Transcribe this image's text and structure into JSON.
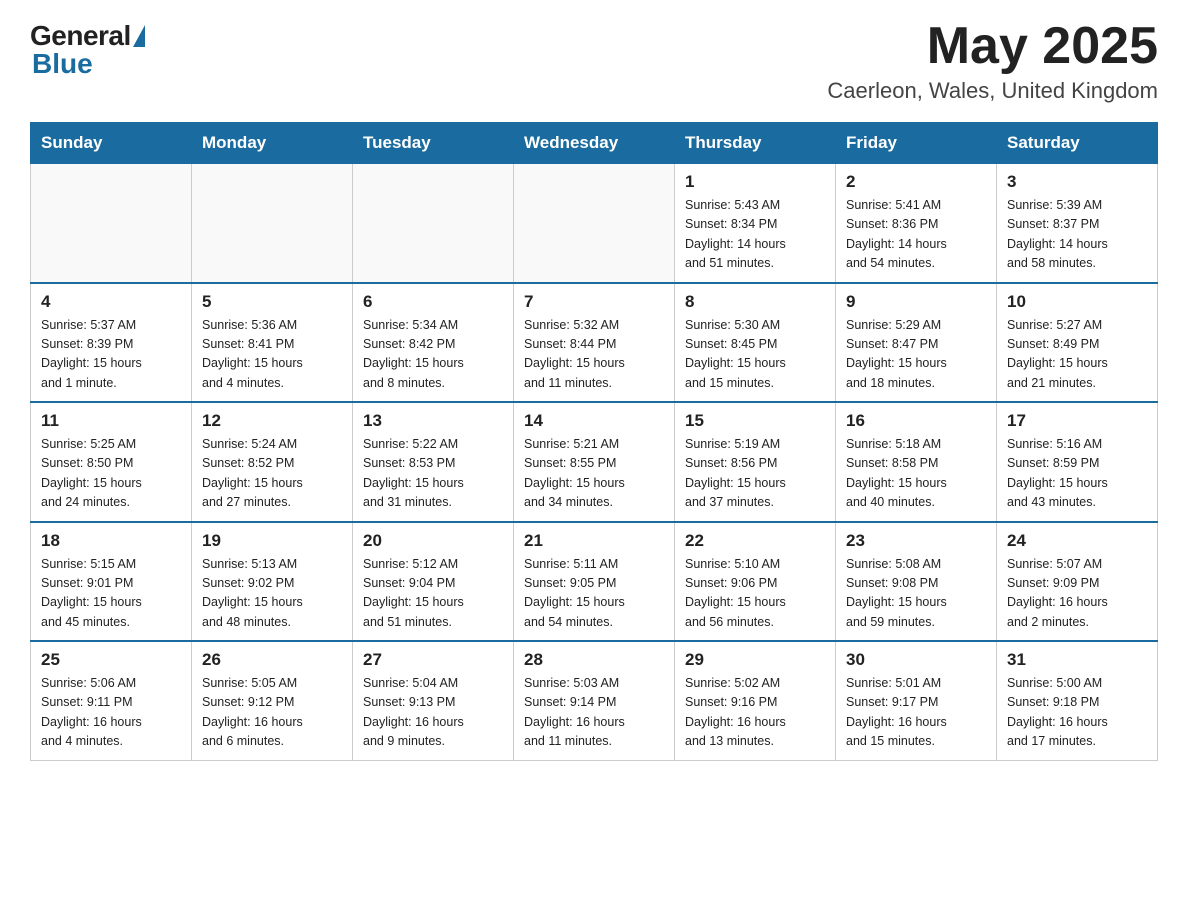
{
  "header": {
    "logo_general": "General",
    "logo_blue": "Blue",
    "month_title": "May 2025",
    "subtitle": "Caerleon, Wales, United Kingdom"
  },
  "days_of_week": [
    "Sunday",
    "Monday",
    "Tuesday",
    "Wednesday",
    "Thursday",
    "Friday",
    "Saturday"
  ],
  "weeks": [
    [
      {
        "day": "",
        "info": ""
      },
      {
        "day": "",
        "info": ""
      },
      {
        "day": "",
        "info": ""
      },
      {
        "day": "",
        "info": ""
      },
      {
        "day": "1",
        "info": "Sunrise: 5:43 AM\nSunset: 8:34 PM\nDaylight: 14 hours\nand 51 minutes."
      },
      {
        "day": "2",
        "info": "Sunrise: 5:41 AM\nSunset: 8:36 PM\nDaylight: 14 hours\nand 54 minutes."
      },
      {
        "day": "3",
        "info": "Sunrise: 5:39 AM\nSunset: 8:37 PM\nDaylight: 14 hours\nand 58 minutes."
      }
    ],
    [
      {
        "day": "4",
        "info": "Sunrise: 5:37 AM\nSunset: 8:39 PM\nDaylight: 15 hours\nand 1 minute."
      },
      {
        "day": "5",
        "info": "Sunrise: 5:36 AM\nSunset: 8:41 PM\nDaylight: 15 hours\nand 4 minutes."
      },
      {
        "day": "6",
        "info": "Sunrise: 5:34 AM\nSunset: 8:42 PM\nDaylight: 15 hours\nand 8 minutes."
      },
      {
        "day": "7",
        "info": "Sunrise: 5:32 AM\nSunset: 8:44 PM\nDaylight: 15 hours\nand 11 minutes."
      },
      {
        "day": "8",
        "info": "Sunrise: 5:30 AM\nSunset: 8:45 PM\nDaylight: 15 hours\nand 15 minutes."
      },
      {
        "day": "9",
        "info": "Sunrise: 5:29 AM\nSunset: 8:47 PM\nDaylight: 15 hours\nand 18 minutes."
      },
      {
        "day": "10",
        "info": "Sunrise: 5:27 AM\nSunset: 8:49 PM\nDaylight: 15 hours\nand 21 minutes."
      }
    ],
    [
      {
        "day": "11",
        "info": "Sunrise: 5:25 AM\nSunset: 8:50 PM\nDaylight: 15 hours\nand 24 minutes."
      },
      {
        "day": "12",
        "info": "Sunrise: 5:24 AM\nSunset: 8:52 PM\nDaylight: 15 hours\nand 27 minutes."
      },
      {
        "day": "13",
        "info": "Sunrise: 5:22 AM\nSunset: 8:53 PM\nDaylight: 15 hours\nand 31 minutes."
      },
      {
        "day": "14",
        "info": "Sunrise: 5:21 AM\nSunset: 8:55 PM\nDaylight: 15 hours\nand 34 minutes."
      },
      {
        "day": "15",
        "info": "Sunrise: 5:19 AM\nSunset: 8:56 PM\nDaylight: 15 hours\nand 37 minutes."
      },
      {
        "day": "16",
        "info": "Sunrise: 5:18 AM\nSunset: 8:58 PM\nDaylight: 15 hours\nand 40 minutes."
      },
      {
        "day": "17",
        "info": "Sunrise: 5:16 AM\nSunset: 8:59 PM\nDaylight: 15 hours\nand 43 minutes."
      }
    ],
    [
      {
        "day": "18",
        "info": "Sunrise: 5:15 AM\nSunset: 9:01 PM\nDaylight: 15 hours\nand 45 minutes."
      },
      {
        "day": "19",
        "info": "Sunrise: 5:13 AM\nSunset: 9:02 PM\nDaylight: 15 hours\nand 48 minutes."
      },
      {
        "day": "20",
        "info": "Sunrise: 5:12 AM\nSunset: 9:04 PM\nDaylight: 15 hours\nand 51 minutes."
      },
      {
        "day": "21",
        "info": "Sunrise: 5:11 AM\nSunset: 9:05 PM\nDaylight: 15 hours\nand 54 minutes."
      },
      {
        "day": "22",
        "info": "Sunrise: 5:10 AM\nSunset: 9:06 PM\nDaylight: 15 hours\nand 56 minutes."
      },
      {
        "day": "23",
        "info": "Sunrise: 5:08 AM\nSunset: 9:08 PM\nDaylight: 15 hours\nand 59 minutes."
      },
      {
        "day": "24",
        "info": "Sunrise: 5:07 AM\nSunset: 9:09 PM\nDaylight: 16 hours\nand 2 minutes."
      }
    ],
    [
      {
        "day": "25",
        "info": "Sunrise: 5:06 AM\nSunset: 9:11 PM\nDaylight: 16 hours\nand 4 minutes."
      },
      {
        "day": "26",
        "info": "Sunrise: 5:05 AM\nSunset: 9:12 PM\nDaylight: 16 hours\nand 6 minutes."
      },
      {
        "day": "27",
        "info": "Sunrise: 5:04 AM\nSunset: 9:13 PM\nDaylight: 16 hours\nand 9 minutes."
      },
      {
        "day": "28",
        "info": "Sunrise: 5:03 AM\nSunset: 9:14 PM\nDaylight: 16 hours\nand 11 minutes."
      },
      {
        "day": "29",
        "info": "Sunrise: 5:02 AM\nSunset: 9:16 PM\nDaylight: 16 hours\nand 13 minutes."
      },
      {
        "day": "30",
        "info": "Sunrise: 5:01 AM\nSunset: 9:17 PM\nDaylight: 16 hours\nand 15 minutes."
      },
      {
        "day": "31",
        "info": "Sunrise: 5:00 AM\nSunset: 9:18 PM\nDaylight: 16 hours\nand 17 minutes."
      }
    ]
  ]
}
